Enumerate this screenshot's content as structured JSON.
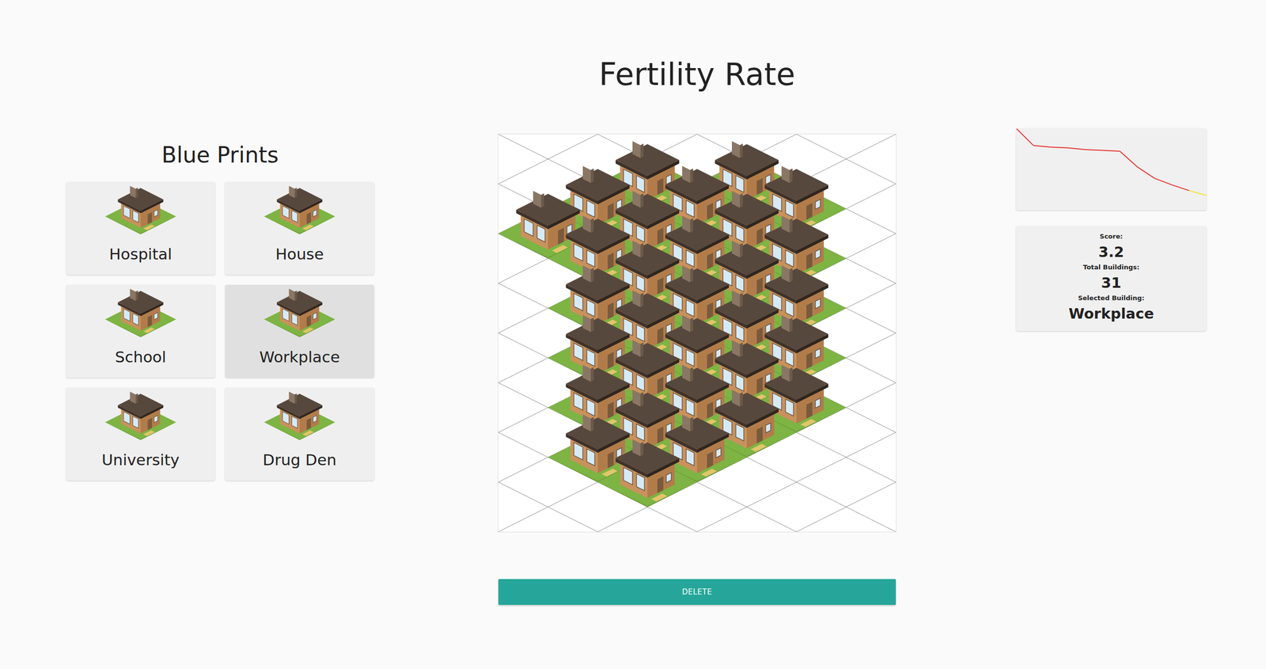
{
  "title": "Fertility Rate",
  "blueprints": {
    "title": "Blue Prints",
    "items": [
      {
        "label": "Hospital",
        "selected": false
      },
      {
        "label": "House",
        "selected": false
      },
      {
        "label": "School",
        "selected": false
      },
      {
        "label": "Workplace",
        "selected": true
      },
      {
        "label": "University",
        "selected": false
      },
      {
        "label": "Drug Den",
        "selected": false
      }
    ]
  },
  "map": {
    "tiles": [
      [
        false,
        false,
        false
      ],
      [
        false,
        true,
        true,
        false
      ],
      [
        true,
        true,
        true
      ],
      [
        true,
        true,
        true,
        false
      ],
      [
        true,
        true,
        true
      ],
      [
        false,
        true,
        true,
        false
      ],
      [
        true,
        true,
        true
      ],
      [
        false,
        true,
        true,
        false
      ],
      [
        true,
        true,
        true
      ],
      [
        false,
        true,
        true,
        false
      ],
      [
        true,
        true,
        true
      ],
      [
        false,
        true,
        true,
        false
      ],
      [
        true,
        true,
        false
      ],
      [
        false,
        true,
        false,
        false
      ],
      [
        false,
        false,
        false
      ]
    ]
  },
  "chart": {
    "points": [
      {
        "value": 100,
        "color": "#e53935"
      },
      {
        "value": 79,
        "color": "#e53935"
      },
      {
        "value": 77,
        "color": "#e53935"
      },
      {
        "value": 76,
        "color": "#e53935"
      },
      {
        "value": 74,
        "color": "#e53935"
      },
      {
        "value": 73,
        "color": "#e53935"
      },
      {
        "value": 72,
        "color": "#e53935"
      },
      {
        "value": 53,
        "color": "#e53935"
      },
      {
        "value": 39,
        "color": "#e53935"
      },
      {
        "value": 31,
        "color": "#e53935"
      },
      {
        "value": 24,
        "color": "#e53935"
      },
      {
        "value": 18,
        "color": "#f2e533"
      }
    ]
  },
  "stats": [
    {
      "label": "Score:",
      "value": "3.2"
    },
    {
      "label": "Total Buildings:",
      "value": "31"
    },
    {
      "label": "Selected Building:",
      "value": "Workplace"
    }
  ],
  "buttons": [
    "DELETE"
  ]
}
